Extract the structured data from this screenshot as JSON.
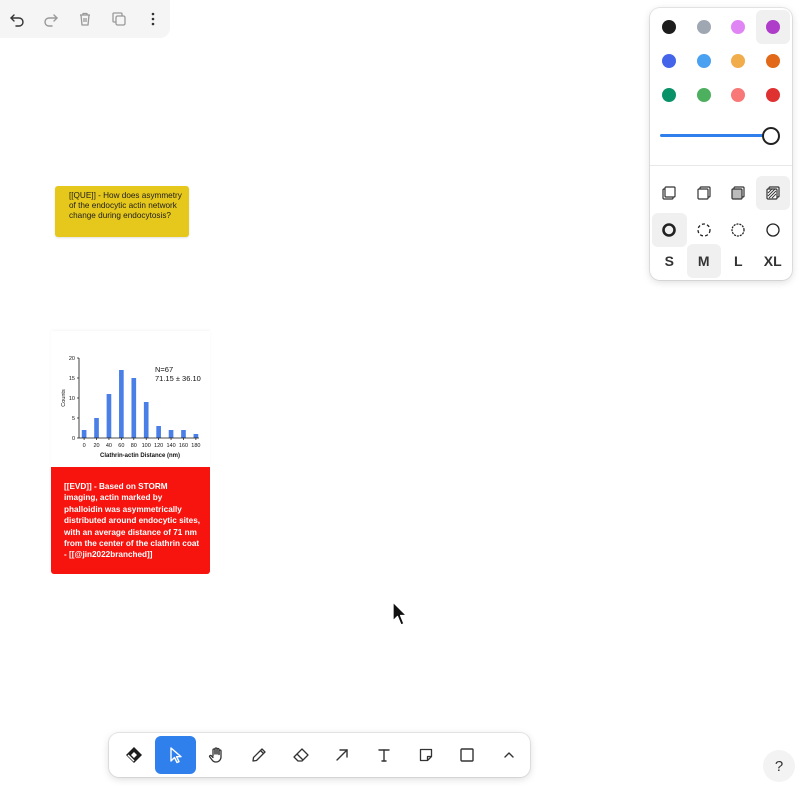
{
  "action_bar": {
    "buttons": [
      {
        "icon": "undo-icon"
      },
      {
        "icon": "redo-icon"
      },
      {
        "icon": "trash-icon"
      },
      {
        "icon": "duplicate-icon"
      },
      {
        "icon": "more-icon"
      }
    ]
  },
  "style_panel": {
    "colors": [
      [
        "#1d1d1d",
        "#9fa8b2",
        "#e085f4",
        "#ae3ec9"
      ],
      [
        "#4465e9",
        "#4ba1f1",
        "#f1ac4b",
        "#e16919"
      ],
      [
        "#099268",
        "#4cb05e",
        "#f87777",
        "#e03131"
      ]
    ],
    "selected_color": "#ae3ec9",
    "opacity_percent": 100,
    "fill_options": [
      "fill-none-icon",
      "fill-semi-icon",
      "fill-solid-icon",
      "fill-pattern-icon"
    ],
    "selected_fill": "fill-pattern-icon",
    "dash_options": [
      "dash-draw-icon",
      "dash-dashed-icon",
      "dash-dotted-icon",
      "dash-solid-icon"
    ],
    "selected_dash": "dash-draw-icon",
    "sizes": [
      "S",
      "M",
      "L",
      "XL"
    ],
    "selected_size": "M"
  },
  "canvas": {
    "question_note": "[[QUE]] - How does asymmetry of the endocytic actin network change during endocytosis?",
    "evidence_note": "[[EVD]] - Based on STORM imaging, actin marked by phalloidin was asymmetrically distributed around endocytic sites, with an average distance of 71 nm from the center of the clathrin coat - [[@jin2022branched]]"
  },
  "chart_data": {
    "type": "bar",
    "xlabel": "Clathrin-actin Distance (nm)",
    "ylabel": "Counts",
    "x_ticks": [
      "0",
      "20",
      "40",
      "60",
      "80",
      "100",
      "120",
      "140",
      "160",
      "180"
    ],
    "y_ticks": [
      "0",
      "5",
      "10",
      "15",
      "20"
    ],
    "ylim": [
      0,
      20
    ],
    "bins": [
      0,
      10,
      20,
      30,
      40,
      50,
      60,
      70,
      80,
      90,
      100,
      110,
      120,
      130,
      140,
      150,
      160,
      170,
      180
    ],
    "values": [
      2,
      5,
      11,
      17,
      15,
      9,
      3,
      2,
      2,
      1
    ],
    "bin_centers": [
      0,
      20,
      40,
      60,
      80,
      100,
      120,
      140,
      160,
      180
    ],
    "annotation_n": "N=67",
    "annotation_mean": "71.15 ± 36.10",
    "bar_color": "#4a7fe8"
  },
  "toolbar": {
    "tools": [
      {
        "icon": "logo-icon",
        "name": "menu"
      },
      {
        "icon": "select-icon",
        "name": "select"
      },
      {
        "icon": "hand-icon",
        "name": "hand"
      },
      {
        "icon": "draw-icon",
        "name": "draw"
      },
      {
        "icon": "eraser-icon",
        "name": "eraser"
      },
      {
        "icon": "arrow-icon",
        "name": "arrow"
      },
      {
        "icon": "text-icon",
        "name": "text"
      },
      {
        "icon": "note-icon",
        "name": "note"
      },
      {
        "icon": "rectangle-icon",
        "name": "rectangle"
      },
      {
        "icon": "chevron-up-icon",
        "name": "more"
      }
    ],
    "selected_tool": "select"
  },
  "help_label": "?"
}
